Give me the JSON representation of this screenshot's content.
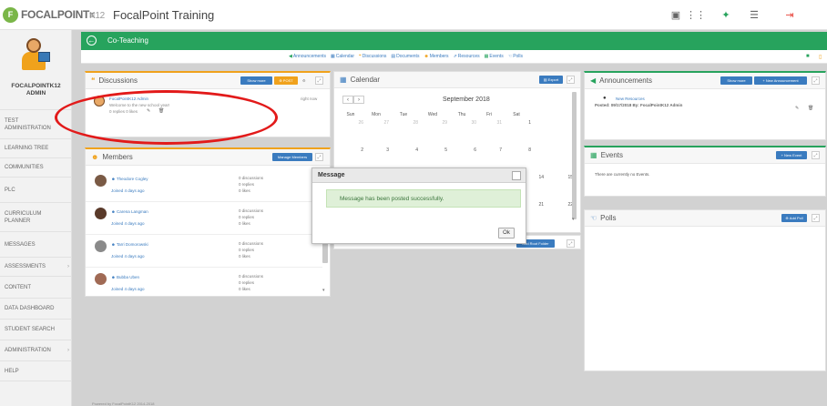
{
  "topbar": {
    "logo_text": "FOCALPOINT",
    "logo_suffix": "K12",
    "app_title": "FocalPoint Training"
  },
  "sidebar": {
    "user_name_line1": "FOCALPOINTK12",
    "user_name_line2": "ADMIN",
    "items": [
      {
        "label": "TEST ADMINISTRATION"
      },
      {
        "label": "LEARNING TREE"
      },
      {
        "label": "COMMUNITIES"
      },
      {
        "label": "PLC"
      },
      {
        "label": "CURRICULUM PLANNER"
      },
      {
        "label": "MESSAGES"
      },
      {
        "label": "ASSESSMENTS"
      },
      {
        "label": "CONTENT"
      },
      {
        "label": "DATA DASHBOARD"
      },
      {
        "label": "STUDENT SEARCH"
      },
      {
        "label": "ADMINISTRATION"
      },
      {
        "label": "HELP"
      }
    ]
  },
  "page": {
    "title": "Co-Teaching",
    "tabs": [
      "Announcements",
      "Calendar",
      "Discussions",
      "Documents",
      "Members",
      "Resources",
      "Events",
      "Polls"
    ]
  },
  "discussions": {
    "title": "Discussions",
    "btn_hide": "Show more",
    "btn_post": "POST",
    "post_author": "FocalPointK12 Admin",
    "post_time": "right now",
    "post_text": "Welcome to the new school year!",
    "post_meta": "0 replies   0 likes"
  },
  "members": {
    "title": "Members",
    "manage_btn": "Manage Members",
    "list": [
      {
        "name": "Theodore Cogley",
        "joined": "Joined 4 days ago",
        "discussions": "0 discussions",
        "replies": "0 replies",
        "likes": "0 likes"
      },
      {
        "name": "Carena Langman",
        "joined": "Joined 4 days ago",
        "discussions": "0 discussions",
        "replies": "0 replies",
        "likes": "0 likes"
      },
      {
        "name": "Tarri Domorowski",
        "joined": "Joined 4 days ago",
        "discussions": "0 discussions",
        "replies": "0 replies",
        "likes": "0 likes"
      },
      {
        "name": "Bubba Uben",
        "joined": "Joined 4 days ago",
        "discussions": "0 discussions",
        "replies": "0 replies",
        "likes": "0 likes"
      }
    ]
  },
  "calendar": {
    "title": "Calendar",
    "export_btn": "Export",
    "month": "September 2018",
    "days": [
      "Sun",
      "Mon",
      "Tue",
      "Wed",
      "Thu",
      "Fri",
      "Sat"
    ],
    "week1": [
      "26",
      "27",
      "28",
      "29",
      "30",
      "31",
      "1"
    ],
    "week2": [
      "2",
      "3",
      "4",
      "5",
      "6",
      "7",
      "8"
    ],
    "week2b": [
      "14",
      "15"
    ],
    "week3b": [
      "21",
      "22"
    ]
  },
  "documents": {
    "add_folder_btn": "Add Root Folder"
  },
  "announcements": {
    "title": "Announcements",
    "show_btn": "Show more",
    "new_btn": "New Announcement",
    "item_title": "New Resources",
    "item_meta": "Posted: 09/17/2018   By: FocalPointK12 Admin"
  },
  "events": {
    "title": "Events",
    "new_btn": "New Event",
    "empty": "There are currently no Events."
  },
  "polls": {
    "title": "Polls",
    "add_btn": "Add Poll"
  },
  "modal": {
    "title": "Message",
    "message": "Message has been posted successfully.",
    "ok": "Ok"
  },
  "footer": {
    "text": "Powered by FocalPointK12 2014-2018"
  },
  "colors": {
    "green": "#27a35d",
    "orange": "#f0a21c",
    "blue": "#3a7bbf",
    "highlight": "#e21a1a"
  }
}
